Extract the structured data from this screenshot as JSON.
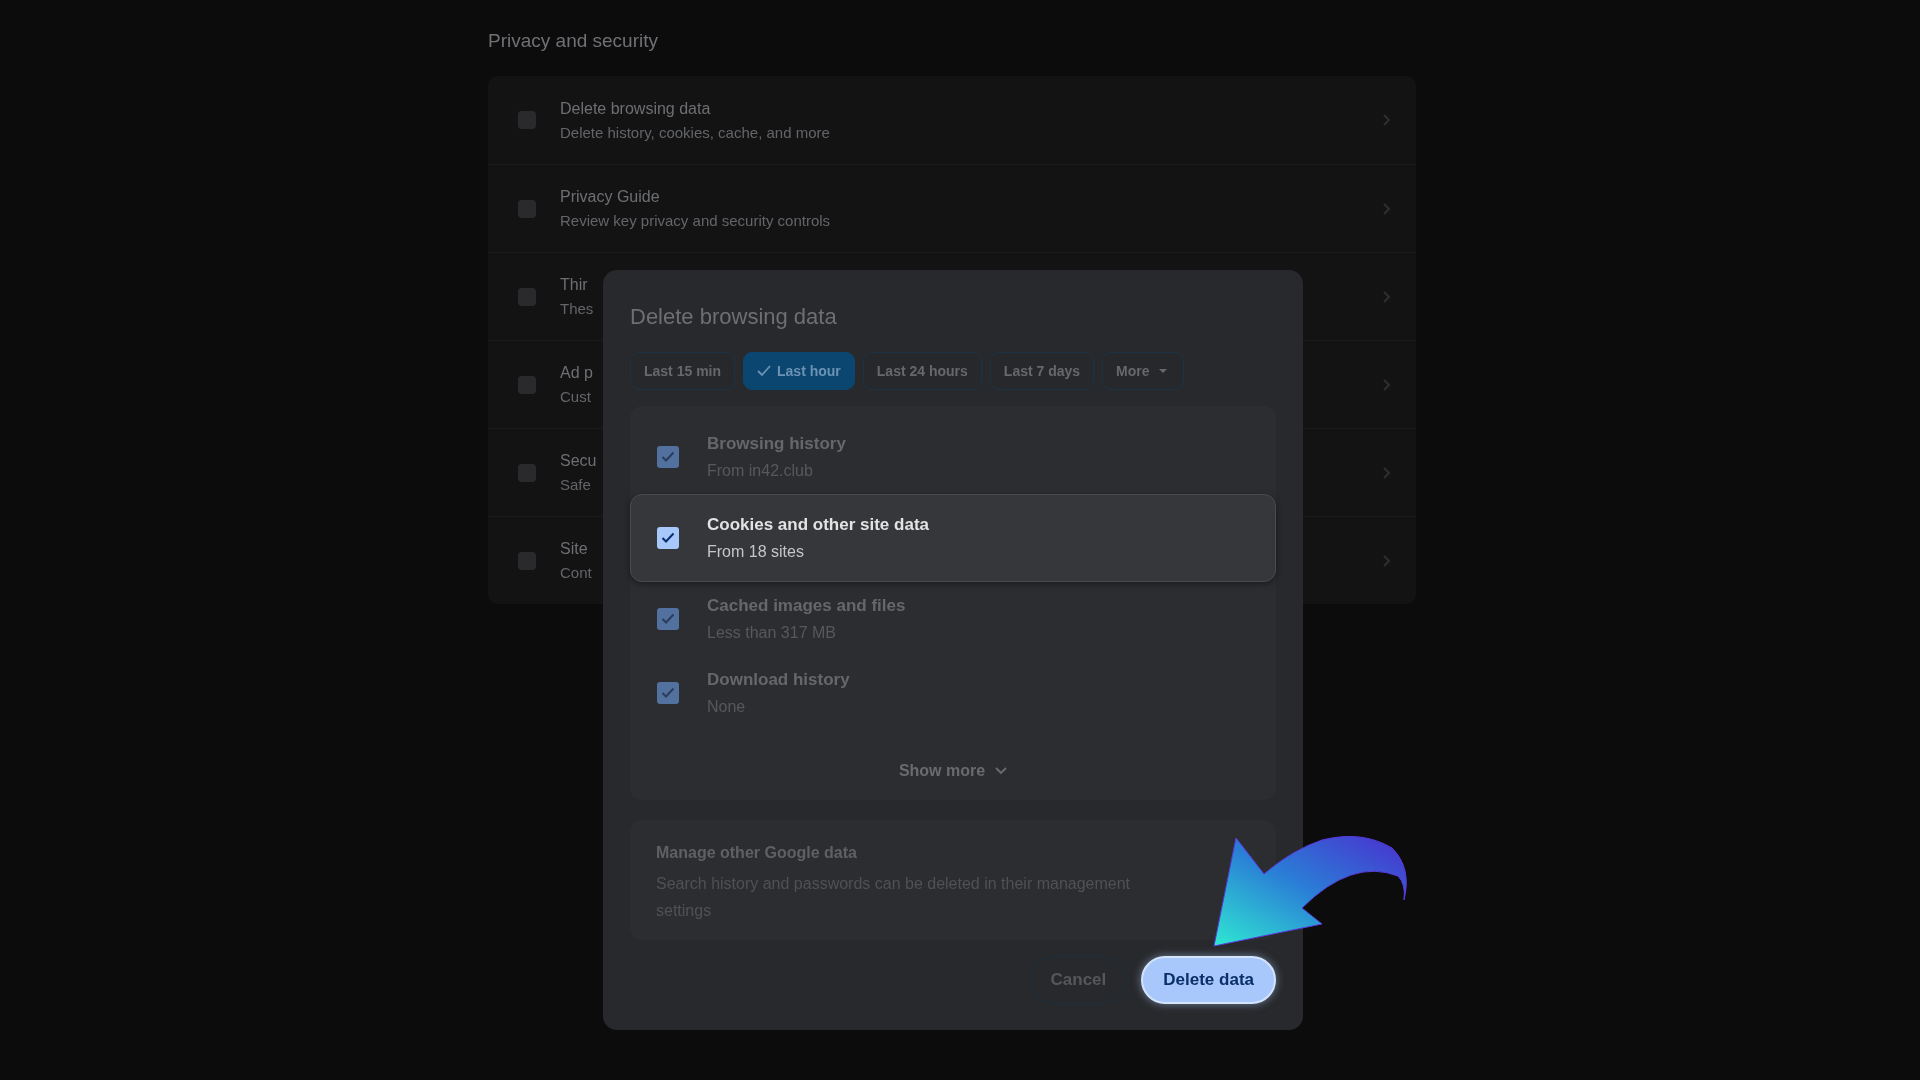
{
  "settings": {
    "section_title": "Privacy and security",
    "rows": [
      {
        "title": "Delete browsing data",
        "subtitle": "Delete history, cookies, cache, and more"
      },
      {
        "title": "Privacy Guide",
        "subtitle": "Review key privacy and security controls"
      },
      {
        "title": "Thir",
        "subtitle": "Thes"
      },
      {
        "title": "Ad p",
        "subtitle": "Cust"
      },
      {
        "title": "Secu",
        "subtitle": "Safe"
      },
      {
        "title": "Site",
        "subtitle": "Cont"
      }
    ]
  },
  "dialog": {
    "title": "Delete browsing data",
    "time_ranges": [
      {
        "label": "Last 15 min",
        "selected": false,
        "kind": "chip"
      },
      {
        "label": "Last hour",
        "selected": true,
        "kind": "chip"
      },
      {
        "label": "Last 24 hours",
        "selected": false,
        "kind": "chip"
      },
      {
        "label": "Last 7 days",
        "selected": false,
        "kind": "chip"
      },
      {
        "label": "More",
        "selected": false,
        "kind": "dropdown"
      }
    ],
    "items": [
      {
        "title": "Browsing history",
        "subtitle": "From in42.club",
        "checked": true,
        "highlighted": false
      },
      {
        "title": "Cookies and other site data",
        "subtitle": "From 18 sites",
        "checked": true,
        "highlighted": true
      },
      {
        "title": "Cached images and files",
        "subtitle": "Less than 317 MB",
        "checked": true,
        "highlighted": false
      },
      {
        "title": "Download history",
        "subtitle": "None",
        "checked": true,
        "highlighted": false
      }
    ],
    "show_more": "Show more",
    "manage": {
      "title": "Manage other Google data",
      "text": "Search history and passwords can be deleted in their management settings"
    },
    "buttons": [
      {
        "label": "Cancel",
        "kind": "secondary",
        "highlighted": false
      },
      {
        "label": "Delete data",
        "kind": "primary",
        "highlighted": true
      }
    ]
  }
}
